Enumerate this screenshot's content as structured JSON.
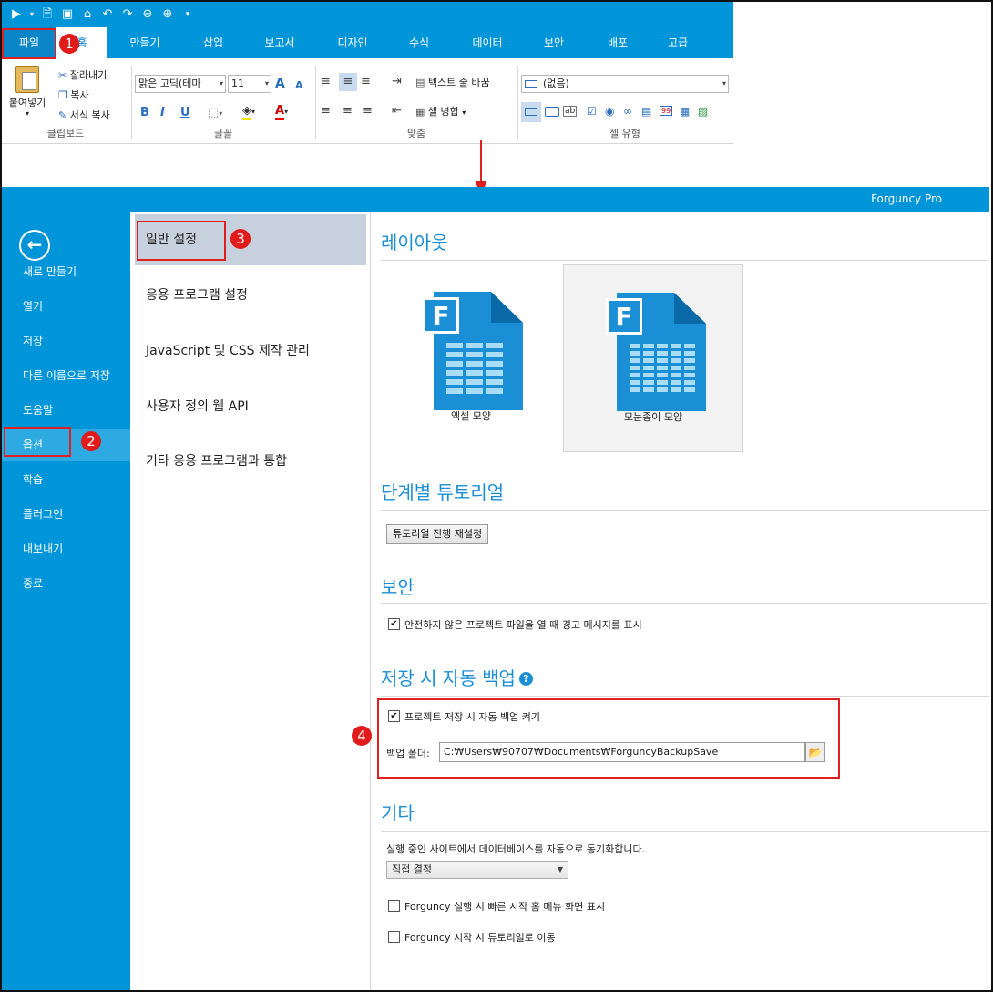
{
  "ribbon": {
    "qat_icons": [
      "run-icon",
      "dropdown-icon",
      "new-doc-icon",
      "save-icon",
      "open-folder-icon",
      "undo-icon",
      "redo-icon",
      "back-icon",
      "forward-icon",
      "customize-icon"
    ],
    "tabs": [
      {
        "label": "파일",
        "state": "file"
      },
      {
        "label": "홈",
        "state": "active"
      },
      {
        "label": "만들기"
      },
      {
        "label": "삽입"
      },
      {
        "label": "보고서"
      },
      {
        "label": "디자인"
      },
      {
        "label": "수식"
      },
      {
        "label": "데이터"
      },
      {
        "label": "보안"
      },
      {
        "label": "배포"
      },
      {
        "label": "고급"
      }
    ],
    "clipboard": {
      "paste": "붙여넣기",
      "cut": "잘라내기",
      "copy": "복사",
      "format_painter": "서식 복사",
      "group": "클립보드"
    },
    "font": {
      "family": "맑은 고딕(테마",
      "size": "11",
      "bold": "B",
      "italic": "I",
      "underline": "U",
      "grow": "A",
      "shrink": "A",
      "font_color": "A",
      "group": "글꼴"
    },
    "alignment": {
      "wrap_text": "텍스트 줄 바꿈",
      "merge_cells": "셀 병합",
      "group": "맞춤"
    },
    "cell_type": {
      "value": "(없음)",
      "group": "셀 유형"
    }
  },
  "backstage": {
    "product": "Forguncy Pro",
    "nav": [
      "새로 만들기",
      "열기",
      "저장",
      "다른 이름으로 저장",
      "도움말",
      "옵션",
      "학습",
      "플러그인",
      "내보내기",
      "종료"
    ],
    "nav_active_index": 5,
    "sub_nav": [
      "일반 설정",
      "응용 프로그램 설정",
      "JavaScript 및 CSS 제작 관리",
      "사용자 정의 웹 API",
      "기타 응용 프로그램과 통합"
    ],
    "sub_active_index": 0,
    "sections": {
      "layout": {
        "title": "레이아웃",
        "options": [
          {
            "label": "엑셀 모양",
            "selected": false
          },
          {
            "label": "모눈종이 모양",
            "selected": true
          }
        ]
      },
      "tutorial": {
        "title": "단계별 튜토리얼",
        "reset_button": "튜토리얼 진행 재설정"
      },
      "security": {
        "title": "보안",
        "warn_unsafe": {
          "label": "안전하지 않은 프로젝트 파일을 열 때 경고 메시지를 표시",
          "checked": true
        }
      },
      "backup": {
        "title": "저장 시 자동 백업",
        "help": "?",
        "enable": {
          "label": "프로젝트 저장 시 자동 백업 켜기",
          "checked": true
        },
        "folder_label": "백업 폴더:",
        "folder_value": "C:₩Users₩90707₩Documents₩ForguncyBackupSave"
      },
      "other": {
        "title": "기타",
        "sync_label": "실행 중인 사이트에서 데이터베이스를 자동으로 동기화합니다.",
        "sync_value": "직접 결정",
        "quick_start": {
          "label": "Forguncy 실행 시 빠른 시작 홈 메뉴 화면 표시",
          "checked": false
        },
        "go_tutorial": {
          "label": "Forguncy 시작 시 튜토리얼로 이동",
          "checked": false
        }
      }
    }
  },
  "annotations": [
    "1",
    "2",
    "3",
    "4"
  ],
  "colors": {
    "accent": "#0095d9",
    "highlight": "#e02020",
    "section_title": "#1b8fd6"
  }
}
